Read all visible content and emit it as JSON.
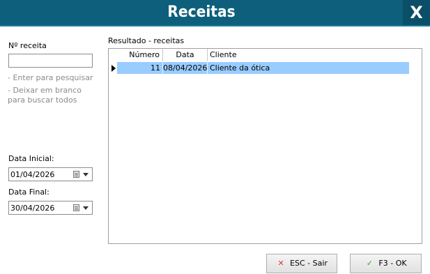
{
  "window": {
    "title": "Receitas",
    "close_label": "X"
  },
  "filters": {
    "numero_label": "Nº receita",
    "numero_value": "",
    "hint_enter": "- Enter para pesquisar",
    "hint_blank": "- Deixar em branco para buscar todos",
    "data_inicial_label": "Data Inicial:",
    "data_inicial_value": "01/04/2026",
    "data_final_label": "Data Final:",
    "data_final_value": "30/04/2026"
  },
  "results": {
    "title": "Resultado - receitas",
    "columns": [
      "Número",
      "Data",
      "Cliente"
    ],
    "rows": [
      {
        "numero": "11",
        "data": "08/04/2026",
        "cliente": "Cliente da ótica"
      }
    ]
  },
  "buttons": {
    "esc_label": "ESC - Sair",
    "ok_label": "F3 - OK"
  },
  "colors": {
    "titlebar": "#0d5f7b",
    "selected_row": "#99ccff",
    "esc_icon": "#d83b3b",
    "ok_icon": "#3aa03a"
  }
}
